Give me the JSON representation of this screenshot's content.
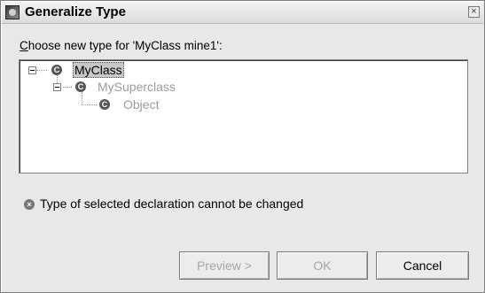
{
  "window": {
    "title": "Generalize Type",
    "close_glyph": "×"
  },
  "prompt": {
    "mnemonic": "C",
    "rest": "hoose new type for 'MyClass mine1':"
  },
  "tree": {
    "nodes": [
      {
        "label": "MyClass",
        "icon": "class-icon",
        "selected": true,
        "enabled": true
      },
      {
        "label": "MySuperclass",
        "icon": "class-icon",
        "selected": false,
        "enabled": false
      },
      {
        "label": "Object",
        "icon": "class-icon",
        "selected": false,
        "enabled": false
      }
    ],
    "class_icon_glyph": "C"
  },
  "status": {
    "icon": "error-icon",
    "icon_glyph": "×",
    "message": "Type of selected declaration cannot be changed"
  },
  "buttons": {
    "preview_label": "Preview >",
    "ok_label": "OK",
    "cancel_label": "Cancel"
  }
}
